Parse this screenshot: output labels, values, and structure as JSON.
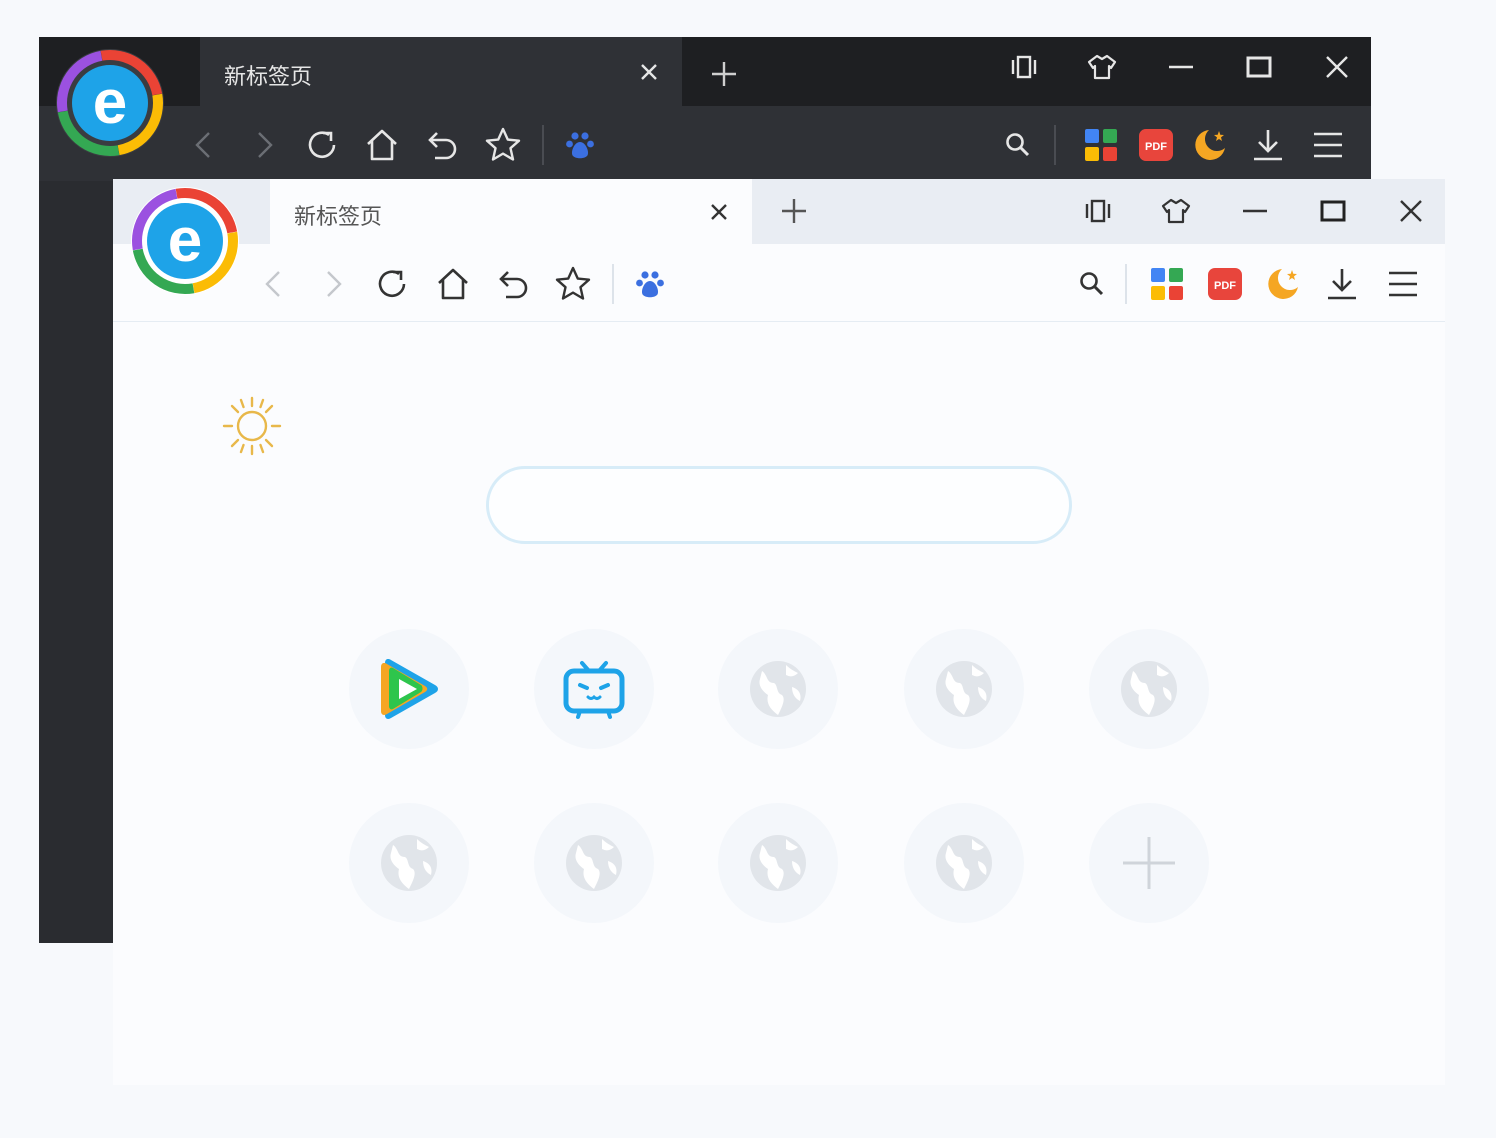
{
  "colors": {
    "dark_bg": "#25272b",
    "light_bg": "#fbfcfe",
    "baidu_blue": "#3b6fe0",
    "pdf_red": "#e8453c",
    "moon_orange": "#f5a623",
    "weather_sun": "#e8b84a"
  },
  "dark_window": {
    "tab": {
      "title": "新标签页",
      "close_icon": "close-icon"
    },
    "new_tab_icon": "plus-icon",
    "window_controls": [
      "fullscreen-icon",
      "skin-icon",
      "minimize-icon",
      "maximize-icon",
      "close-icon"
    ],
    "toolbar_icons": [
      "back-icon",
      "forward-icon",
      "refresh-icon",
      "home-icon",
      "undo-icon",
      "star-icon",
      "baidu-paw-icon"
    ],
    "right_icons": [
      "search-icon",
      "apps-icon",
      "pdf-icon",
      "night-mode-icon",
      "download-icon",
      "menu-icon"
    ]
  },
  "light_window": {
    "tab": {
      "title": "新标签页",
      "close_icon": "close-icon"
    },
    "new_tab_icon": "plus-icon",
    "window_controls": [
      "fullscreen-icon",
      "skin-icon",
      "minimize-icon",
      "maximize-icon",
      "close-icon"
    ],
    "toolbar_icons": [
      "back-icon",
      "forward-icon",
      "refresh-icon",
      "home-icon",
      "undo-icon",
      "star-icon",
      "baidu-paw-icon"
    ],
    "right_icons": [
      "search-icon",
      "apps-icon",
      "pdf-icon",
      "night-mode-icon",
      "download-icon",
      "menu-icon"
    ],
    "pdf_badge": "PDF"
  },
  "page": {
    "weather_icon": "sun-icon",
    "search": {
      "value": "",
      "placeholder": ""
    },
    "tiles": [
      {
        "icon": "tencent-video-icon",
        "label": ""
      },
      {
        "icon": "bilibili-icon",
        "label": ""
      },
      {
        "icon": "globe-icon",
        "label": ""
      },
      {
        "icon": "globe-icon",
        "label": ""
      },
      {
        "icon": "globe-icon",
        "label": ""
      },
      {
        "icon": "globe-icon",
        "label": ""
      },
      {
        "icon": "globe-icon",
        "label": ""
      },
      {
        "icon": "globe-icon",
        "label": ""
      },
      {
        "icon": "globe-icon",
        "label": ""
      },
      {
        "icon": "add-tile-icon",
        "label": ""
      }
    ]
  }
}
